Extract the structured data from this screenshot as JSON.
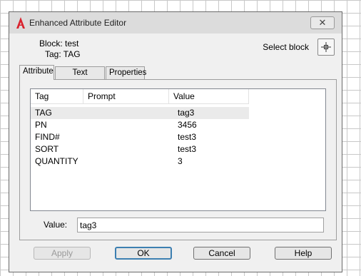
{
  "window": {
    "title": "Enhanced Attribute Editor",
    "close_symbol": "✕"
  },
  "info": {
    "block_label": "Block: test",
    "tag_label": "Tag: TAG",
    "select_block_label": "Select block"
  },
  "tabs": [
    {
      "label": "Attribute",
      "active": true
    },
    {
      "label": "Text Options",
      "active": false
    },
    {
      "label": "Properties",
      "active": false
    }
  ],
  "attribute_list": {
    "columns": [
      "Tag",
      "Prompt",
      "Value"
    ],
    "rows": [
      {
        "tag": "TAG",
        "prompt": "",
        "value": "tag3",
        "selected": true
      },
      {
        "tag": "PN",
        "prompt": "",
        "value": "3456",
        "selected": false
      },
      {
        "tag": "FIND#",
        "prompt": "",
        "value": "test3",
        "selected": false
      },
      {
        "tag": "SORT",
        "prompt": "",
        "value": "test3",
        "selected": false
      },
      {
        "tag": "QUANTITY",
        "prompt": "",
        "value": "3",
        "selected": false
      }
    ]
  },
  "value_field": {
    "label": "Value:",
    "value": "tag3"
  },
  "buttons": {
    "apply": "Apply",
    "ok": "OK",
    "cancel": "Cancel",
    "help": "Help"
  },
  "icons": {
    "app_logo": "autocad-logo-icon",
    "select_block": "crosshair-pick-icon",
    "close": "close-icon"
  },
  "colors": {
    "logo_red": "#d9232e",
    "default_button_border": "#3c7fb1"
  }
}
